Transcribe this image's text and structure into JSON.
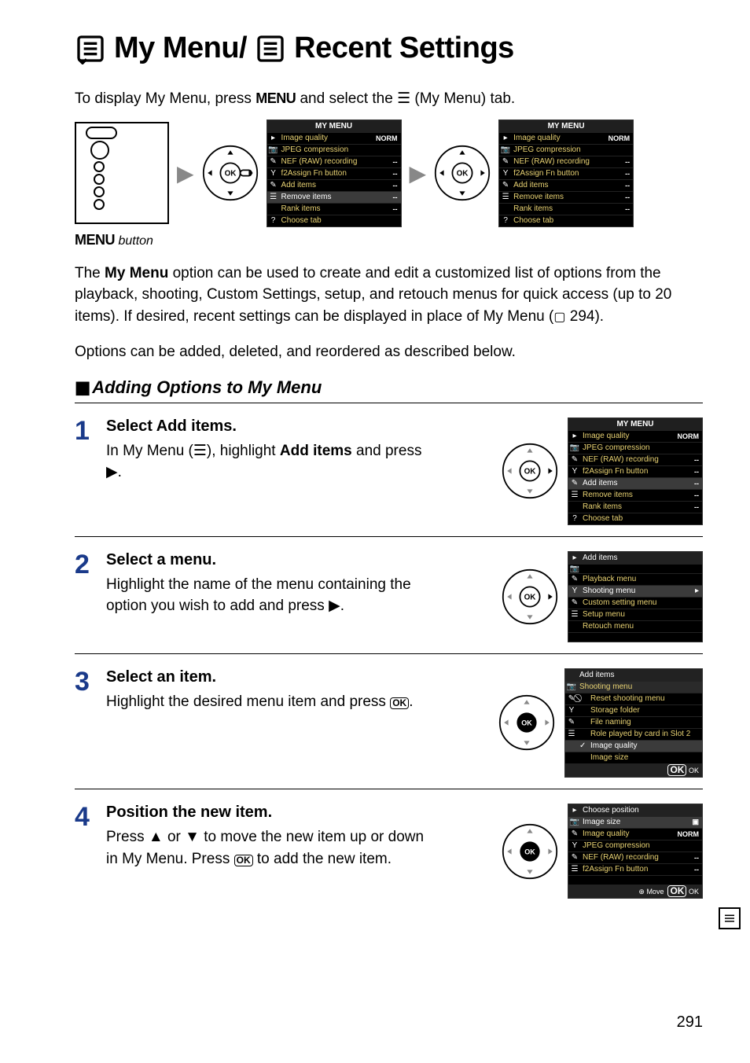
{
  "title": {
    "part1": "My Menu/",
    "part2": "Recent Settings"
  },
  "intro": {
    "prefix": "To display My Menu, press ",
    "menu_word": "MENU",
    "suffix": " and select the ",
    "tab_text": " (My Menu) tab."
  },
  "figure_caption": {
    "menu_word": "MENU",
    "suffix": " button"
  },
  "my_menu_panel": {
    "title": "MY MENU",
    "rows": [
      {
        "label": "Image quality",
        "value": "NORM"
      },
      {
        "label": "JPEG compression",
        "value": ""
      },
      {
        "label": "NEF (RAW) recording",
        "value": "--"
      },
      {
        "label": "f2Assign Fn button",
        "value": "--"
      },
      {
        "label": "Add items",
        "value": "--"
      },
      {
        "label": "Remove items",
        "value": "--"
      },
      {
        "label": "Rank items",
        "value": "--"
      },
      {
        "label": "Choose tab",
        "value": ""
      }
    ]
  },
  "body1": {
    "prefix": "The ",
    "bold": "My Menu",
    "rest": " option can be used to create and edit a customized list of options from the playback, shooting, Custom Settings, setup, and retouch menus for quick access (up to 20 items).  If desired, recent settings can be displayed in place of My Menu (",
    "ref": " 294)."
  },
  "body2": "Options can be added, deleted, and reordered as described below.",
  "subheading": "Adding Options to My Menu",
  "steps": {
    "s1": {
      "num": "1",
      "title": "Select Add items.",
      "text_pre": "In My Menu (",
      "text_mid": "), highlight ",
      "text_bold": "Add items",
      "text_post": " and press ",
      "text_end": "."
    },
    "s2": {
      "num": "2",
      "title": "Select a menu.",
      "text": "Highlight the name of the menu containing the option you wish to add and press ",
      "text_end": "."
    },
    "s3": {
      "num": "3",
      "title": "Select an item.",
      "text": "Highlight the desired menu item and press ",
      "text_end": "."
    },
    "s4": {
      "num": "4",
      "title": "Position the new item.",
      "text_pre": "Press ",
      "text_mid1": " or ",
      "text_mid2": " to move the new item up or down in My Menu.  Press ",
      "text_post": " to add the new item."
    }
  },
  "panel_step1": {
    "title": "MY MENU",
    "rows": [
      {
        "label": "Image quality",
        "value": "NORM"
      },
      {
        "label": "JPEG compression",
        "value": ""
      },
      {
        "label": "NEF (RAW) recording",
        "value": "--"
      },
      {
        "label": "f2Assign Fn button",
        "value": "--"
      },
      {
        "label": "Add items",
        "value": "--",
        "hl": true
      },
      {
        "label": "Remove items",
        "value": "--"
      },
      {
        "label": "Rank items",
        "value": "--"
      },
      {
        "label": "Choose tab",
        "value": ""
      }
    ]
  },
  "panel_step2": {
    "title": "Add items",
    "rows": [
      {
        "label": "Playback menu"
      },
      {
        "label": "Shooting menu",
        "hl": true,
        "arrow": true
      },
      {
        "label": "Custom setting menu"
      },
      {
        "label": "Setup menu"
      },
      {
        "label": "Retouch menu"
      }
    ]
  },
  "panel_step3": {
    "title": "Add items",
    "subtitle": "Shooting menu",
    "rows": [
      {
        "label": "Reset shooting menu"
      },
      {
        "label": "Storage folder"
      },
      {
        "label": "File naming"
      },
      {
        "label": "Role played by card in Slot 2"
      },
      {
        "label": "Image quality",
        "hl": true,
        "check": true
      },
      {
        "label": "Image size"
      }
    ],
    "footer": "OK"
  },
  "panel_step4": {
    "title": "Choose position",
    "rows": [
      {
        "label": "Image size",
        "hl": true,
        "icon": true
      },
      {
        "label": "Image quality",
        "value": "NORM"
      },
      {
        "label": "JPEG compression",
        "value": ""
      },
      {
        "label": "NEF (RAW) recording",
        "value": "--"
      },
      {
        "label": "f2Assign Fn button",
        "value": "--"
      }
    ],
    "footer_l": "Move",
    "footer_r": "OK"
  },
  "page_number": "291"
}
